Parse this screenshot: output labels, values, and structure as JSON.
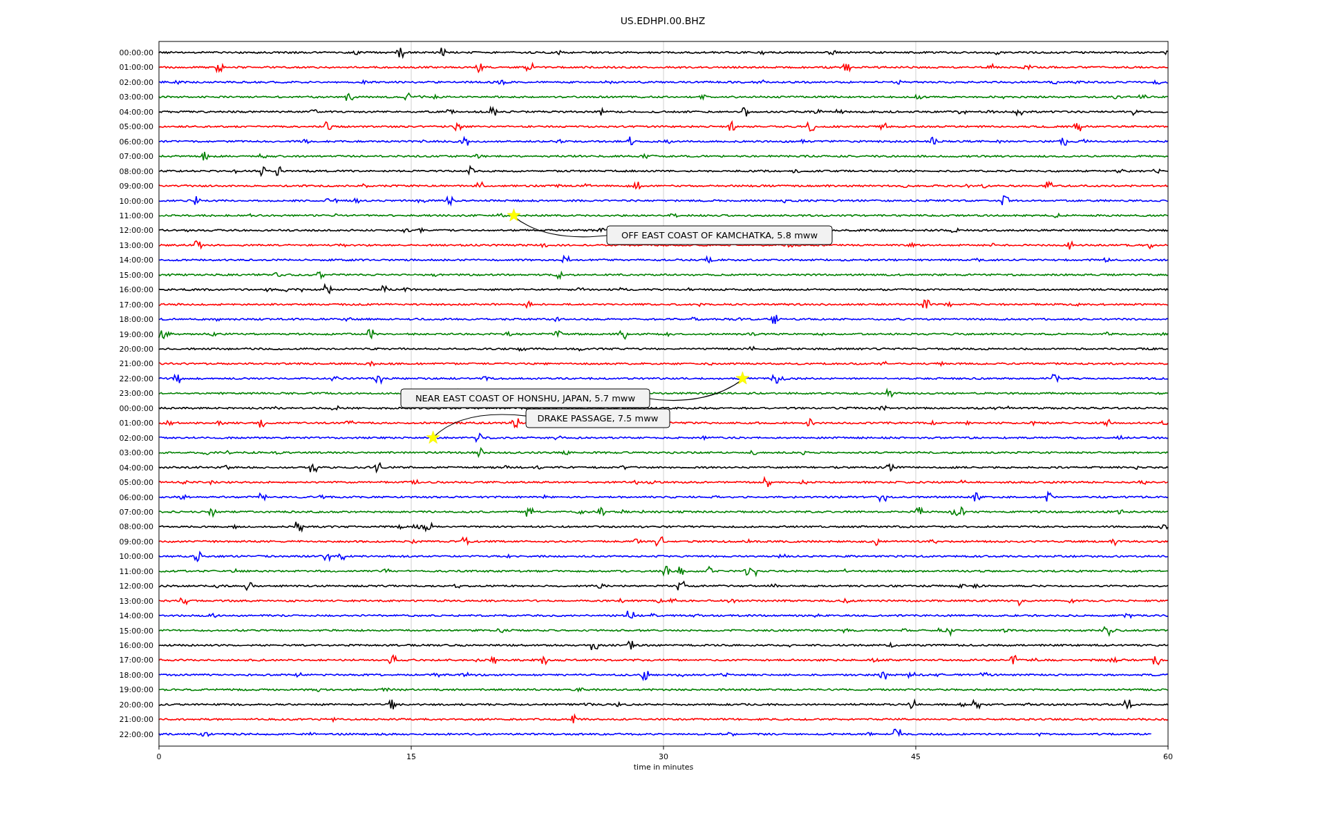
{
  "title": "US.EDHPI.00.BHZ",
  "traces": [
    {
      "label": "00:00:00",
      "color": "#000000"
    },
    {
      "label": "01:00:00",
      "color": "#ff0000"
    },
    {
      "label": "02:00:00",
      "color": "#0000ff"
    },
    {
      "label": "03:00:00",
      "color": "#008000"
    },
    {
      "label": "04:00:00",
      "color": "#000000"
    },
    {
      "label": "05:00:00",
      "color": "#ff0000"
    },
    {
      "label": "06:00:00",
      "color": "#0000ff"
    },
    {
      "label": "07:00:00",
      "color": "#008000"
    },
    {
      "label": "08:00:00",
      "color": "#000000"
    },
    {
      "label": "09:00:00",
      "color": "#ff0000"
    },
    {
      "label": "10:00:00",
      "color": "#0000ff"
    },
    {
      "label": "11:00:00",
      "color": "#008000"
    },
    {
      "label": "12:00:00",
      "color": "#000000"
    },
    {
      "label": "13:00:00",
      "color": "#ff0000"
    },
    {
      "label": "14:00:00",
      "color": "#0000ff"
    },
    {
      "label": "15:00:00",
      "color": "#008000"
    },
    {
      "label": "16:00:00",
      "color": "#000000"
    },
    {
      "label": "17:00:00",
      "color": "#ff0000"
    },
    {
      "label": "18:00:00",
      "color": "#0000ff"
    },
    {
      "label": "19:00:00",
      "color": "#008000"
    },
    {
      "label": "20:00:00",
      "color": "#000000"
    },
    {
      "label": "21:00:00",
      "color": "#ff0000"
    },
    {
      "label": "22:00:00",
      "color": "#0000ff"
    },
    {
      "label": "23:00:00",
      "color": "#008000"
    },
    {
      "label": "00:00:00",
      "color": "#000000"
    },
    {
      "label": "01:00:00",
      "color": "#ff0000"
    },
    {
      "label": "02:00:00",
      "color": "#0000ff"
    },
    {
      "label": "03:00:00",
      "color": "#008000"
    },
    {
      "label": "04:00:00",
      "color": "#000000"
    },
    {
      "label": "05:00:00",
      "color": "#ff0000"
    },
    {
      "label": "06:00:00",
      "color": "#0000ff"
    },
    {
      "label": "07:00:00",
      "color": "#008000"
    },
    {
      "label": "08:00:00",
      "color": "#000000"
    },
    {
      "label": "09:00:00",
      "color": "#ff0000"
    },
    {
      "label": "10:00:00",
      "color": "#0000ff"
    },
    {
      "label": "11:00:00",
      "color": "#008000"
    },
    {
      "label": "12:00:00",
      "color": "#000000"
    },
    {
      "label": "13:00:00",
      "color": "#ff0000"
    },
    {
      "label": "14:00:00",
      "color": "#0000ff"
    },
    {
      "label": "15:00:00",
      "color": "#008000"
    },
    {
      "label": "16:00:00",
      "color": "#000000"
    },
    {
      "label": "17:00:00",
      "color": "#ff0000"
    },
    {
      "label": "18:00:00",
      "color": "#0000ff"
    },
    {
      "label": "19:00:00",
      "color": "#008000"
    },
    {
      "label": "20:00:00",
      "color": "#000000"
    },
    {
      "label": "21:00:00",
      "color": "#ff0000"
    },
    {
      "label": "22:00:00",
      "color": "#0000ff"
    }
  ],
  "xticks": [
    "0",
    "15",
    "30",
    "45",
    "60"
  ],
  "xlabel": "time in minutes",
  "events": [
    {
      "label": "OFF EAST COAST OF KAMCHATKA, 5.8 mww"
    },
    {
      "label": "NEAR EAST COAST OF HONSHU, JAPAN, 5.7 mww"
    },
    {
      "label": "DRAKE PASSAGE, 7.5 mww"
    }
  ]
}
